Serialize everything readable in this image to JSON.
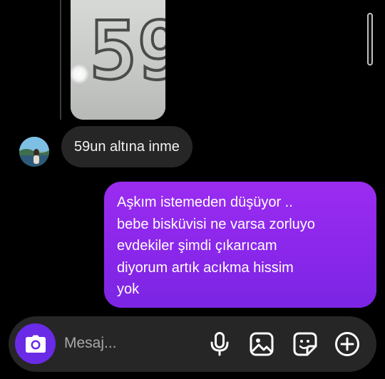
{
  "thread": {
    "scale_reading": "59.",
    "incoming_message": "59un altına inme",
    "outgoing_lines": [
      "Aşkım istemeden düşüyor ..",
      "bebe bisküvisi ne varsa zorluyo",
      "evdekiler şimdi çıkarıcam",
      "diyorum artık acıkma hissim",
      "yok"
    ]
  },
  "composer": {
    "placeholder": "Mesaj...",
    "icons": [
      "camera-icon",
      "microphone-icon",
      "gallery-icon",
      "sticker-icon",
      "add-icon"
    ]
  },
  "colors": {
    "background": "#000000",
    "incoming_bubble": "#262626",
    "outgoing_bubble": "#8a27ea",
    "camera_button": "#6a2be6",
    "composer": "#262626"
  }
}
